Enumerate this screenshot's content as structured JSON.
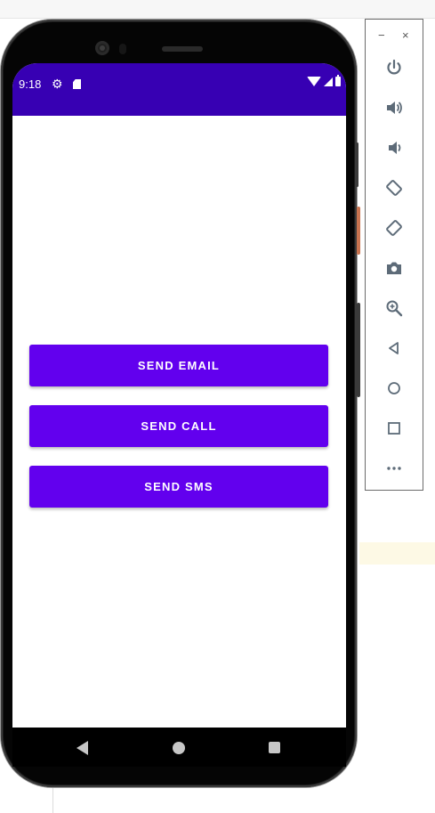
{
  "status_bar": {
    "time": "9:18"
  },
  "buttons": {
    "send_email": "SEND EMAIL",
    "send_call": "SEND CALL",
    "send_sms": "SEND SMS"
  },
  "toolbar": {
    "minimize": "−",
    "close": "×",
    "items": [
      "power-icon",
      "volume-up-icon",
      "volume-down-icon",
      "rotate-left-icon",
      "rotate-right-icon",
      "camera-icon",
      "zoom-icon",
      "back-icon",
      "home-icon",
      "overview-icon",
      "more-icon"
    ]
  },
  "colors": {
    "status_bar": "#3700b3",
    "button": "#6200ee",
    "toolbar_icon": "#5d6b78"
  }
}
